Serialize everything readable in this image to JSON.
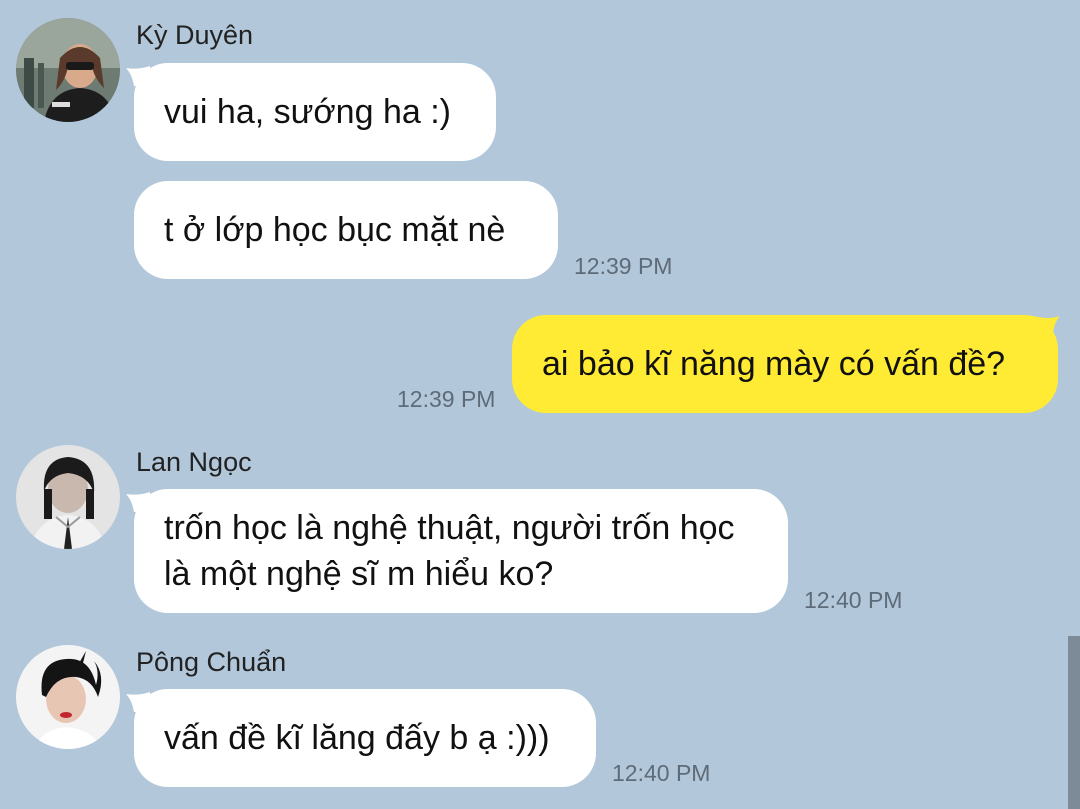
{
  "messages": [
    {
      "sender": "Kỳ Duyên",
      "avatar_icon": "profile-photo-ky-duyen-icon",
      "lines": [
        "vui ha, sướng ha :)",
        "t ở lớp học bục mặt nè"
      ],
      "time": "12:39 PM"
    },
    {
      "sender": "me",
      "lines": [
        "ai bảo kĩ năng mày có vấn đề?"
      ],
      "time": "12:39 PM"
    },
    {
      "sender": "Lan Ngọc",
      "avatar_icon": "profile-photo-lan-ngoc-icon",
      "lines": [
        "trốn học là nghệ thuật, người trốn học là một nghệ sĩ m hiểu ko?"
      ],
      "time": "12:40 PM"
    },
    {
      "sender": "Pông Chuẩn",
      "avatar_icon": "profile-photo-pong-chuan-icon",
      "lines": [
        "vấn đề kĩ lăng đấy b ạ :)))"
      ],
      "time": "12:40 PM"
    }
  ],
  "colors": {
    "background": "#b2c7da",
    "incoming_bubble": "#ffffff",
    "outgoing_bubble": "#ffeb33",
    "timestamp": "#5e6b78"
  }
}
